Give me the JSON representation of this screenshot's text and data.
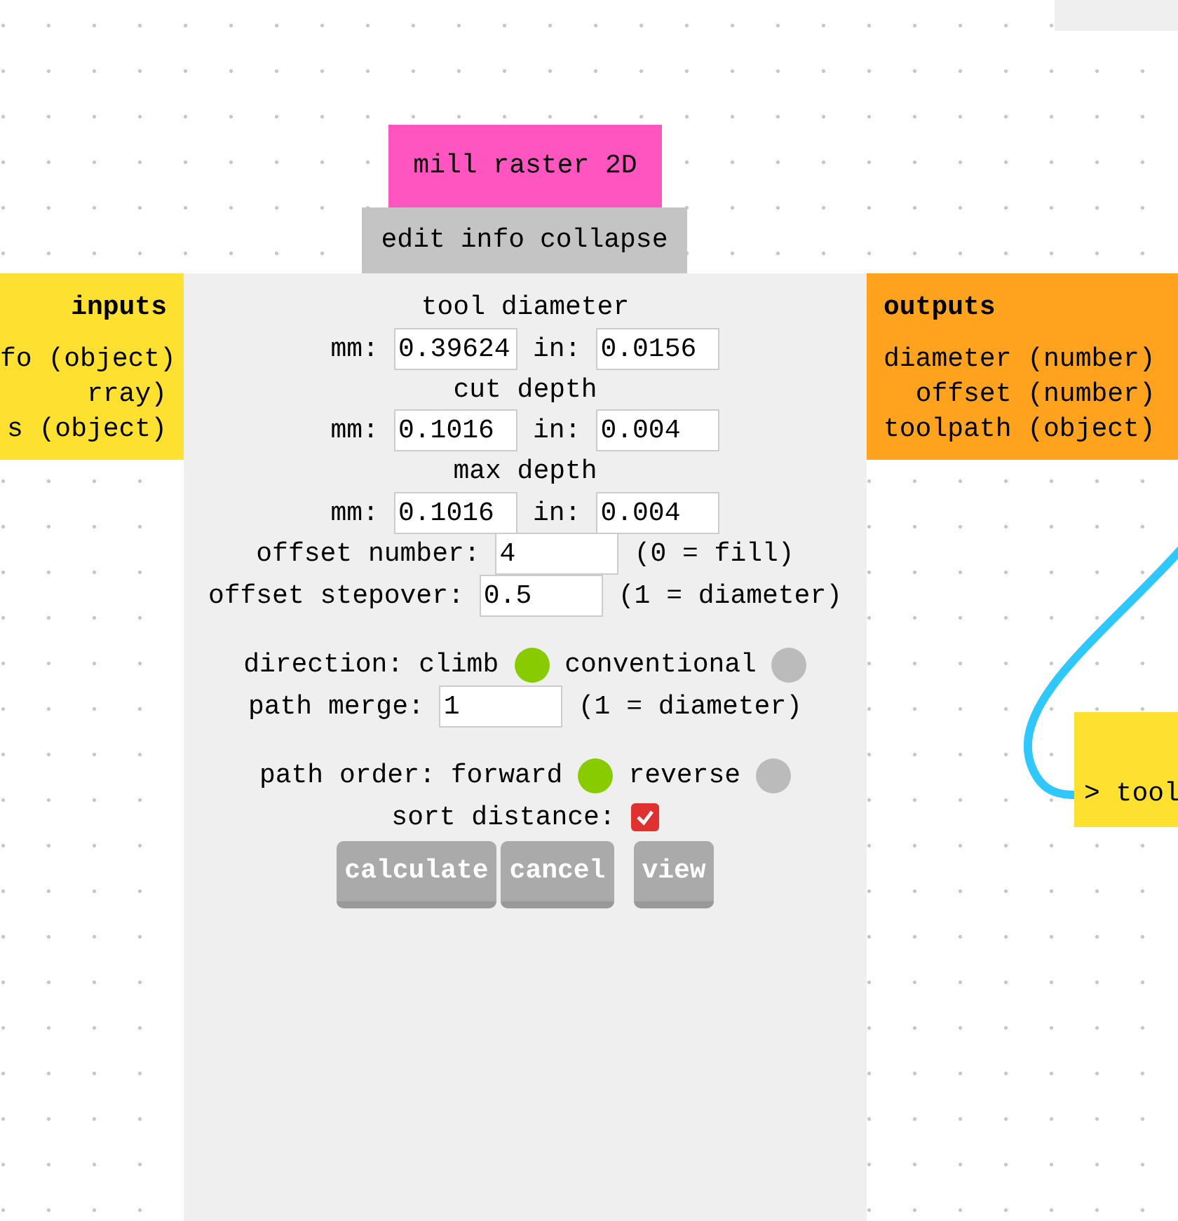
{
  "inputs": {
    "title": "inputs",
    "ports": [
      "fo (object)",
      "rray)",
      "s (object)"
    ]
  },
  "module": {
    "title": "mill raster 2D",
    "menu": [
      {
        "label": "edit"
      },
      {
        "label": "info"
      },
      {
        "label": "collapse"
      }
    ],
    "rows": [
      {
        "kind": "heading",
        "text": "tool diameter"
      },
      {
        "kind": "pair",
        "items": [
          {
            "label": "mm:",
            "value": "0.39624"
          },
          {
            "label": "in:",
            "value": "0.0156"
          }
        ]
      },
      {
        "kind": "heading",
        "text": "cut depth"
      },
      {
        "kind": "pair",
        "items": [
          {
            "label": "mm:",
            "value": "0.1016"
          },
          {
            "label": "in:",
            "value": "0.004"
          }
        ]
      },
      {
        "kind": "heading",
        "text": "max depth"
      },
      {
        "kind": "pair",
        "items": [
          {
            "label": "mm:",
            "value": "0.1016"
          },
          {
            "label": "in:",
            "value": "0.004"
          }
        ]
      },
      {
        "kind": "input",
        "label": "offset number:",
        "value": "4",
        "note": "(0 = fill)"
      },
      {
        "kind": "input",
        "label": "offset stepover:",
        "value": "0.5",
        "note": "(1 = diameter)"
      },
      {
        "kind": "radio",
        "label": "direction:",
        "options": [
          {
            "label": "climb",
            "selected": true
          },
          {
            "label": "conventional",
            "selected": false
          }
        ]
      },
      {
        "kind": "input",
        "label": "path merge:",
        "value": "1",
        "note": "(1 = diameter)"
      },
      {
        "kind": "radio",
        "label": "path order:",
        "options": [
          {
            "label": "forward",
            "selected": true
          },
          {
            "label": "reverse",
            "selected": false
          }
        ]
      },
      {
        "kind": "checkbox",
        "label": "sort distance:",
        "checked": true
      }
    ],
    "buttons": [
      "calculate",
      "cancel",
      "view"
    ]
  },
  "outputs": {
    "title": "outputs",
    "ports": [
      "diameter (number)",
      "offset (number)",
      "toolpath (object)"
    ]
  },
  "next_module": {
    "label": "> tool"
  }
}
